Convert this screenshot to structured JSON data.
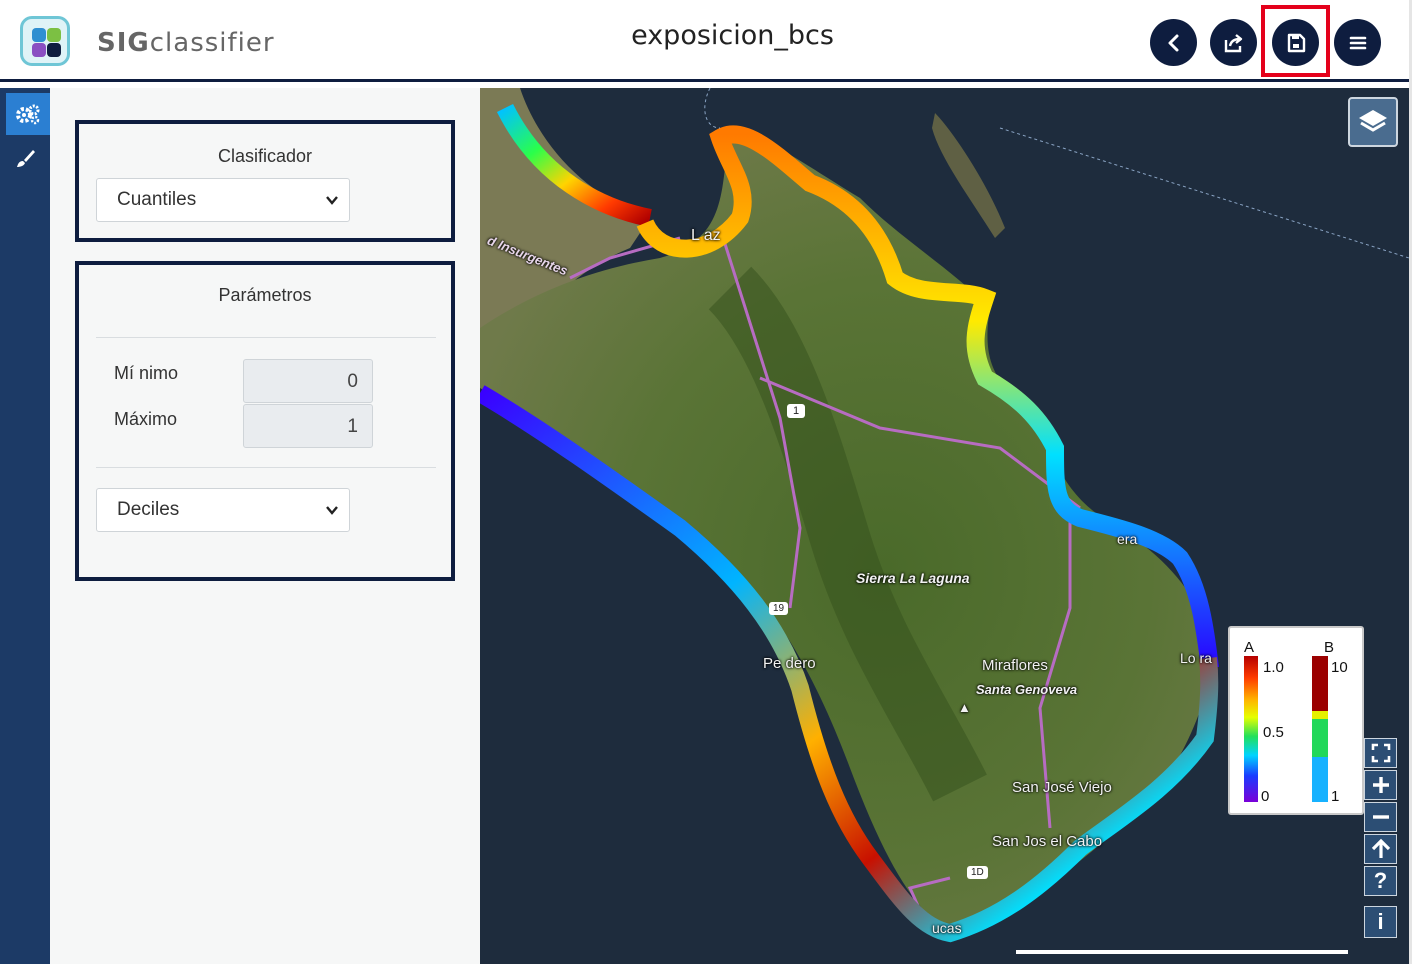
{
  "header": {
    "brand_bold": "SIG",
    "brand_rest": "classifier",
    "title": "exposicion_bcs",
    "buttons": [
      {
        "name": "back",
        "icon": "chevron-left-icon"
      },
      {
        "name": "share",
        "icon": "share-icon"
      },
      {
        "name": "save",
        "icon": "save-icon",
        "highlighted": true
      },
      {
        "name": "menu",
        "icon": "hamburger-icon"
      }
    ]
  },
  "rail": {
    "items": [
      {
        "icon": "settings-cogs-icon",
        "active": true
      },
      {
        "icon": "brush-icon",
        "active": false
      }
    ]
  },
  "clasificador": {
    "title": "Clasificador",
    "selected": "Cuantiles"
  },
  "parametros": {
    "title": "Parámetros",
    "min_label": "Mí nimo",
    "min_value": "0",
    "max_label": "Máximo",
    "max_value": "1",
    "bins_selected": "Deciles"
  },
  "map": {
    "labels": {
      "insurgentes": "d Insurgentes",
      "la_paz": "L  az",
      "sierra": "Sierra La Laguna",
      "pescadero": "Pe   dero",
      "miraflores": "Miraflores",
      "santa_genoveva": "Santa Genoveva",
      "san_jose_viejo": "San José Viejo",
      "san_jose_cabo": "San Jos   el Cabo",
      "buena": "  era",
      "los_frailes": "Lo   ra",
      "cabo": "   ucas",
      "hwy1": "1",
      "hwy19": "19",
      "hwy1d": "1D"
    },
    "legend": {
      "a_title": "A",
      "b_title": "B",
      "a_max": "1.0",
      "a_mid": "0.5",
      "a_min": "0",
      "b_max": "10",
      "b_min": "1"
    },
    "controls": [
      "fullscreen-icon",
      "zoom-in-icon",
      "zoom-out-icon",
      "north-arrow-icon",
      "help-icon",
      "info-icon"
    ],
    "control_glyphs": {
      "help": "?",
      "info": "i"
    }
  },
  "colors": {
    "navy": "#0e1d3f",
    "highlight": "#e4001b",
    "rail": "#1c3a66",
    "rail_active": "#2b7fd2"
  }
}
